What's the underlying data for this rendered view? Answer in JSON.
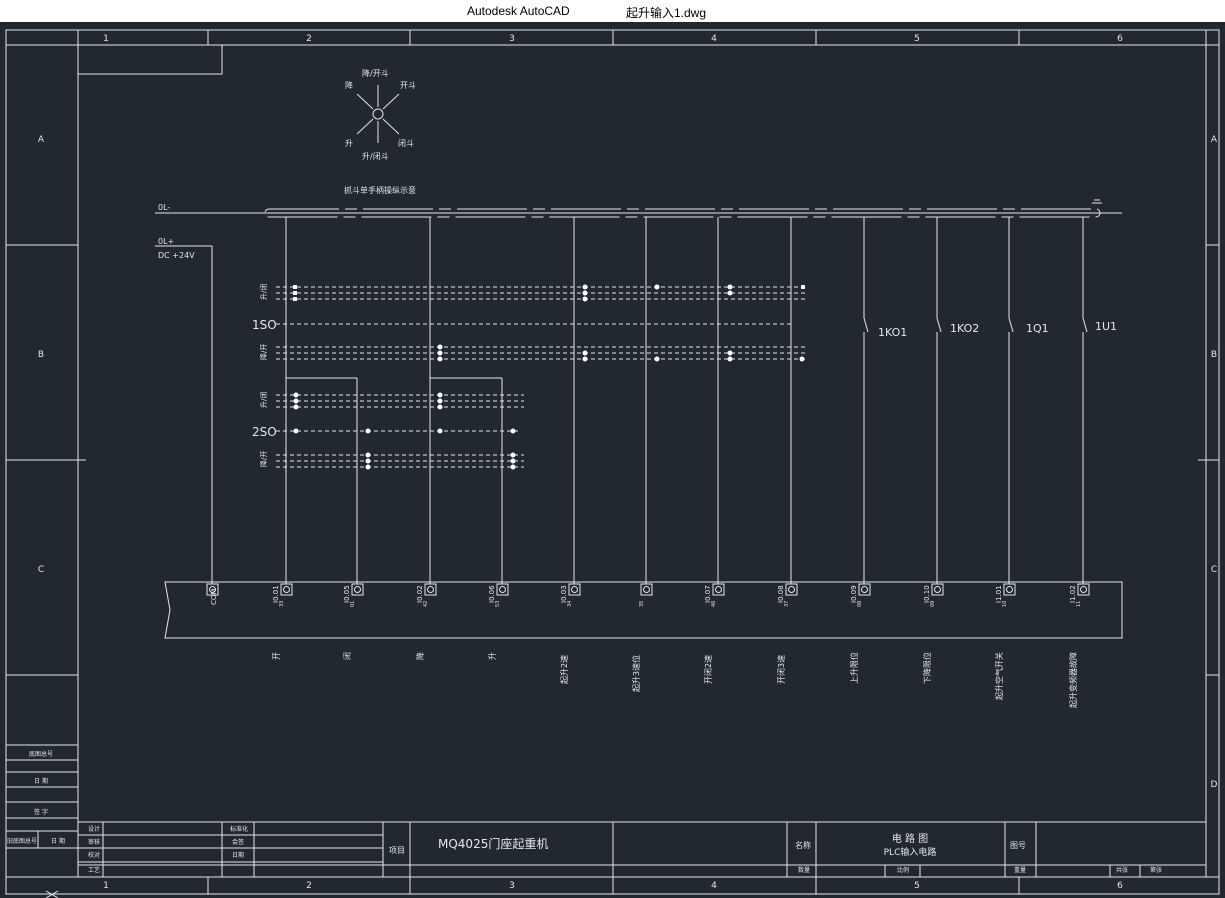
{
  "window": {
    "app_name": "Autodesk AutoCAD",
    "document_name": "起升输入1.dwg"
  },
  "frame": {
    "columns": [
      "1",
      "2",
      "3",
      "4",
      "5",
      "6"
    ],
    "rows_left": [
      "A",
      "B",
      "C"
    ],
    "rows_right": [
      "A",
      "B",
      "C",
      "D"
    ]
  },
  "selector": {
    "top_label": "降/开斗",
    "left_top_label": "降",
    "right_top_label": "开斗",
    "left_bottom_label": "升",
    "right_bottom_label": "闭斗",
    "bottom_label": "升/闭斗",
    "caption": "抓斗单手柄操纵示意"
  },
  "bus": {
    "negative": "0L-",
    "positive": "0L+",
    "voltage": "DC +24V",
    "ground_symbol": "⏚"
  },
  "switches": {
    "s1": "1SO",
    "s2": "2SO",
    "pos_up_close": "升/闭",
    "pos_down_open": "降/开",
    "pos_zero": "0"
  },
  "relays": [
    "1KO1",
    "1KO2",
    "1Q1",
    "1U1"
  ],
  "plc": {
    "com_label": "COM",
    "inputs": [
      {
        "addr": "I0.01",
        "pin": "33",
        "desc": "开"
      },
      {
        "addr": "I0.05",
        "pin": "01",
        "desc": "闭"
      },
      {
        "addr": "I0.02",
        "pin": "42",
        "desc": "降"
      },
      {
        "addr": "I0.06",
        "pin": "53",
        "desc": "升"
      },
      {
        "addr": "I0.03",
        "pin": "34",
        "desc": "起升2速"
      },
      {
        "addr": "",
        "pin": "35",
        "desc": "起升3速位"
      },
      {
        "addr": "I0.07",
        "pin": "46",
        "desc": "开闭2速"
      },
      {
        "addr": "I0.08",
        "pin": "37",
        "desc": "开闭3速"
      },
      {
        "addr": "I0.09",
        "pin": "08",
        "desc": "上升限位"
      },
      {
        "addr": "I0.10",
        "pin": "09",
        "desc": "下降限位"
      },
      {
        "addr": "I1.01",
        "pin": "10",
        "desc": "起升空气开关"
      },
      {
        "addr": "I1.02",
        "pin": "11",
        "desc": "起升变频器故障"
      }
    ]
  },
  "title_block": {
    "left_labels": [
      "底图总号",
      "日 期",
      "签 字",
      "旧底图总号",
      "日 期"
    ],
    "rows": [
      "设计",
      "审核",
      "校对",
      "工艺"
    ],
    "mid_labels": [
      "标准化",
      "会签",
      "日期"
    ],
    "project_label": "项目",
    "project_value": "MQ4025门座起重机",
    "name_label": "名称",
    "drawing_title": "电 路 图",
    "drawing_subtitle": "PLC输入电路",
    "drawing_no_label": "图号",
    "bottom_cells": [
      "数量",
      "比例",
      "重量",
      "共张",
      "第张"
    ]
  }
}
